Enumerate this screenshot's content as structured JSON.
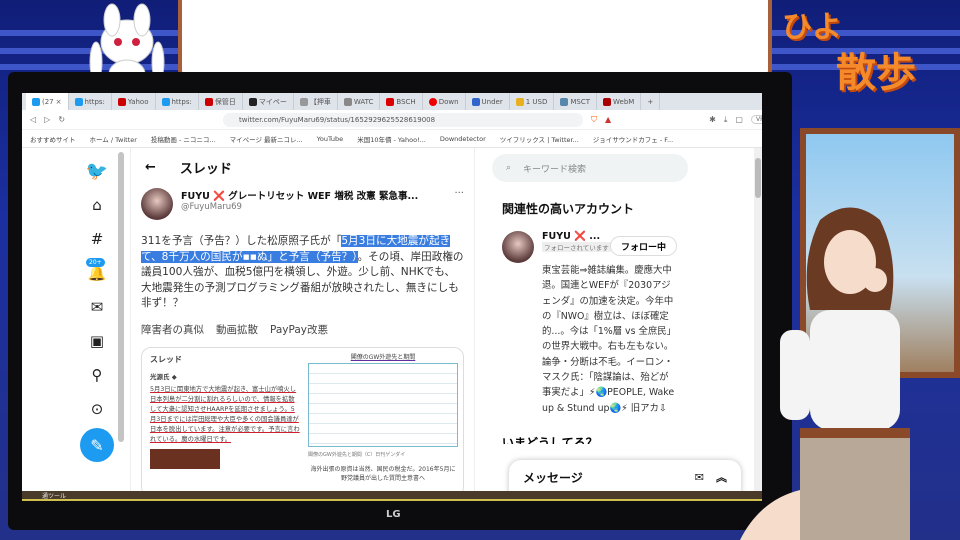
{
  "overlay": {
    "logo_top": "ひよ",
    "logo_bottom": "散歩",
    "monitor_brand": "LG",
    "taskbar_label": "通ツール"
  },
  "browser": {
    "tabs": [
      {
        "label": "(27"
      },
      {
        "label": "https:"
      },
      {
        "label": "Yahoo"
      },
      {
        "label": "https:"
      },
      {
        "label": "保管日"
      },
      {
        "label": "マイペー"
      },
      {
        "label": "【押車"
      },
      {
        "label": "WATC"
      },
      {
        "label": "BSCH"
      },
      {
        "label": "Down"
      },
      {
        "label": "Under"
      },
      {
        "label": "1 USD"
      },
      {
        "label": "MSCT"
      },
      {
        "label": "WebM"
      }
    ],
    "new_tab": "+",
    "url": "twitter.com/FuyuMaru69/status/1652929625528619008",
    "vpn": "VPN",
    "bookmarks": [
      "おすすめサイト",
      "ホーム / Twitter",
      "投稿動画 - ニコニコ...",
      "マイページ 最新ニコレ...",
      "YouTube",
      "米国10年債 - Yahoo!...",
      "Downdetector",
      "ツイフリックス | Twitter...",
      "ジョイサウンドカフェ - F..."
    ]
  },
  "nav": {
    "badge": "20+"
  },
  "thread": {
    "title": "スレッド",
    "author_name": "FUYU",
    "author_x": "❌",
    "author_rest": "グレートリセット WEF 増税 改憲 緊急事...",
    "handle": "@FuyuMaru69",
    "text_before": "311を予言（予告？）した松原照子氏が「",
    "text_highlight": "5月3日に大地震が起きて、8千万人の国民が",
    "text_highlight2": "ぬ」と予言（予告？）",
    "text_after": "。その頃、岸田政権の議員100人強が、血税5億円を横領し、外遊。少し前、NHKでも、大地震発生の予測プログラミング番組が放映されたし、無きにしも非ず！？",
    "tags": [
      "障害者の真似",
      "動画拡散",
      "PayPay改悪"
    ],
    "embed": {
      "title": "スレッド",
      "inner_author": "光源氏 ◆",
      "inner_text": "5月3日に関東地方で大地震が起き、富士山が噴火し日本列島が二分割に割れるらしいので、情報を拡散して大衆に認知させHAARPを延期させましょう。5月3日までには岸田総理や大臣や多くの国会議員達が日本を脱出しています。注意が必要です。予言に言われている。魔の水曜日です。",
      "table_title": "閣僚のGW外遊先と期間",
      "caption": "閣僚のGW外遊先と期間（C）日刊ゲンダイ",
      "footer": "海外出張の原資は当然、国民の税金だ。2016年5月に野党議員が出した質問主意書へ"
    }
  },
  "sidebar": {
    "search_placeholder": "キーワード検索",
    "related_title": "関連性の高いアカウント",
    "account_name": "FUYU ❌ ...",
    "follows_you": "フォローされています",
    "follow_button": "フォロー中",
    "bio": "東宝芸能⇒雑誌編集。慶應大中退。国連とWEFが『2030アジェンダ』の加速を決定。今年中の『NWO』樹立は、ほぼ確定的...。今は「1%層 vs 全庶民」の世界大戦中。右も左もない。論争・分断は不毛。イーロン・マスク氏：「陰謀論は、殆どが事実だよ」⚡🌏PEOPLE, Wake up & Stund up🌏⚡ 旧アカ⇩",
    "trends_partial": "いまどうしてる？",
    "messages": "メッセージ"
  }
}
